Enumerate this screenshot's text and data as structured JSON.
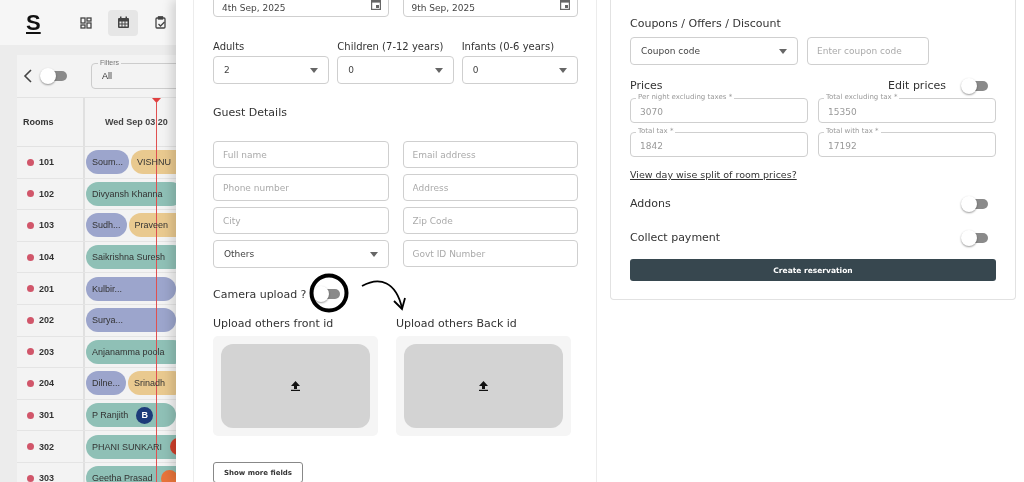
{
  "sidebar": {
    "logo": "S",
    "nav": [
      {
        "kind": "grid",
        "selected": false
      },
      {
        "kind": "calendar",
        "selected": true
      },
      {
        "kind": "clipboard",
        "selected": false
      }
    ]
  },
  "calendar": {
    "view_toggle": {
      "on": false
    },
    "filter": {
      "label": "Filters",
      "value": "All"
    },
    "rooms_heading": "Rooms",
    "date_heading": "Wed Sep 03 20",
    "rooms": [
      {
        "number": "101",
        "bookings": [
          {
            "guest": "Soum...",
            "color": "#9ca5cc"
          },
          {
            "guest": "VISHNU",
            "color": "#e9c98f"
          }
        ]
      },
      {
        "number": "102",
        "bookings": [
          {
            "guest": "Divyansh Khanna",
            "color": "#8fc0b6"
          }
        ]
      },
      {
        "number": "103",
        "bookings": [
          {
            "guest": "Sudh...",
            "color": "#9ca5cc"
          },
          {
            "guest": "Praveen",
            "color": "#e9c98f"
          }
        ]
      },
      {
        "number": "104",
        "bookings": [
          {
            "guest": "Saikrishna Suresh",
            "color": "#8fc0b6"
          }
        ]
      },
      {
        "number": "201",
        "bookings": [
          {
            "guest": "Kulbir...",
            "color": "#9ca5cc"
          }
        ]
      },
      {
        "number": "202",
        "bookings": [
          {
            "guest": "Surya...",
            "color": "#9ca5cc"
          }
        ]
      },
      {
        "number": "203",
        "bookings": [
          {
            "guest": "Anjanamma poola",
            "color": "#8fc0b6"
          }
        ]
      },
      {
        "number": "204",
        "bookings": [
          {
            "guest": "Dilne...",
            "color": "#9ca5cc"
          },
          {
            "guest": "Srinadh",
            "color": "#e9c98f"
          }
        ]
      },
      {
        "number": "301",
        "bookings": [
          {
            "guest": "P Ranjith",
            "color": "#8fc0b6",
            "badge": {
              "kind": "navy",
              "text": "B"
            }
          }
        ]
      },
      {
        "number": "302",
        "bookings": [
          {
            "guest": "PHANI SUNKARI",
            "color": "#8fc0b6",
            "badge": {
              "kind": "red"
            }
          }
        ]
      },
      {
        "number": "303",
        "bookings": [
          {
            "guest": "Geetha Prasad",
            "color": "#8fc0b6",
            "badge": {
              "kind": "orange"
            }
          }
        ]
      }
    ]
  },
  "form": {
    "check_in": "4th Sep, 2025",
    "check_out": "9th Sep, 2025",
    "occupancy": [
      {
        "label": "Adults",
        "value": "2"
      },
      {
        "label": "Children (7-12 years)",
        "value": "0"
      },
      {
        "label": "Infants (0-6 years)",
        "value": "0"
      }
    ],
    "guest_details_heading": "Guest Details",
    "guest_fields": [
      {
        "kind": "input",
        "placeholder": "Full name"
      },
      {
        "kind": "input",
        "placeholder": "Email address"
      },
      {
        "kind": "input",
        "placeholder": "Phone number"
      },
      {
        "kind": "input",
        "placeholder": "Address"
      },
      {
        "kind": "input",
        "placeholder": "City"
      },
      {
        "kind": "input",
        "placeholder": "Zip Code"
      },
      {
        "kind": "select",
        "value": "Others"
      },
      {
        "kind": "input",
        "placeholder": "Govt ID Number"
      }
    ],
    "camera_upload": {
      "label": "Camera upload ?",
      "on": false
    },
    "uploads": [
      {
        "label": "Upload others front id"
      },
      {
        "label": "Upload others Back id"
      }
    ],
    "show_more_button": "Show more fields"
  },
  "summary": {
    "coupons_heading": "Coupons / Offers / Discount",
    "coupon_select": "Coupon code",
    "coupon_input": {
      "placeholder": "Enter coupon code"
    },
    "prices_heading": "Prices",
    "edit_prices": {
      "label": "Edit prices",
      "on": false
    },
    "prices": [
      {
        "label": "Per night excluding taxes *",
        "value": "3070"
      },
      {
        "label": "Total excluding tax *",
        "value": "15350"
      },
      {
        "label": "Total tax *",
        "value": "1842"
      },
      {
        "label": "Total with tax *",
        "value": "17192"
      }
    ],
    "split_link": "View day wise split of room prices?",
    "options": [
      {
        "label": "Addons",
        "on": false
      },
      {
        "label": "Collect payment",
        "on": false
      }
    ],
    "create_button": "Create reservation"
  }
}
